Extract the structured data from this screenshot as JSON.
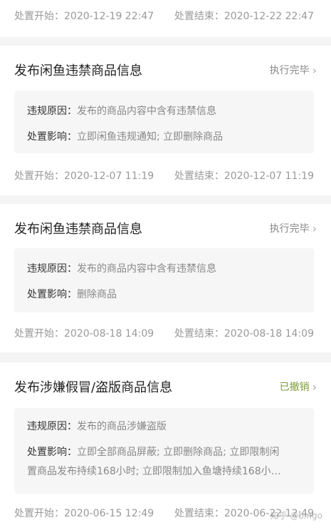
{
  "cards": [
    {
      "title": "",
      "start_label": "处置开始：",
      "start_time": "2020-12-19 22:47",
      "end_label": "处置结束：",
      "end_time": "2020-12-22 22:47"
    },
    {
      "title": "发布闲鱼违禁商品信息",
      "status": "执行完毕",
      "reason_label": "违规原因：",
      "reason": "发布的商品内容中含有违禁信息",
      "impact_label": "处置影响：",
      "impact": "立即闲鱼违规通知; 立即删除商品",
      "start_label": "处置开始：",
      "start_time": "2020-12-07 11:19",
      "end_label": "处置结束：",
      "end_time": "2020-12-07 11:19"
    },
    {
      "title": "发布闲鱼违禁商品信息",
      "status": "执行完毕",
      "reason_label": "违规原因：",
      "reason": "发布的商品内容中含有违禁信息",
      "impact_label": "处置影响：",
      "impact": "删除商品",
      "start_label": "处置开始：",
      "start_time": "2020-08-18 14:09",
      "end_label": "处置结束：",
      "end_time": "2020-08-18 14:09"
    },
    {
      "title": "发布涉嫌假冒/盗版商品信息",
      "status": "已撤销",
      "reason_label": "违规原因：",
      "reason": "发布的商品涉嫌盗版",
      "impact_label": "处置影响：",
      "impact_line1": "立即全部商品屏蔽; 立即删除商品; 立即限制闲",
      "impact_line2": "置商品发布持续168小时; 立即限制加入鱼塘持续168小…",
      "start_label": "处置开始：",
      "start_time": "2020-06-15 12:49",
      "end_label": "处置结束：",
      "end_time": "2020-06-22 12:49"
    }
  ],
  "watermark": "知乎 @bingo",
  "colors": {
    "status_done": "#888888",
    "status_revoked": "#7d9a3a"
  },
  "icons": {
    "status_arrow": "chevron-right-icon"
  }
}
